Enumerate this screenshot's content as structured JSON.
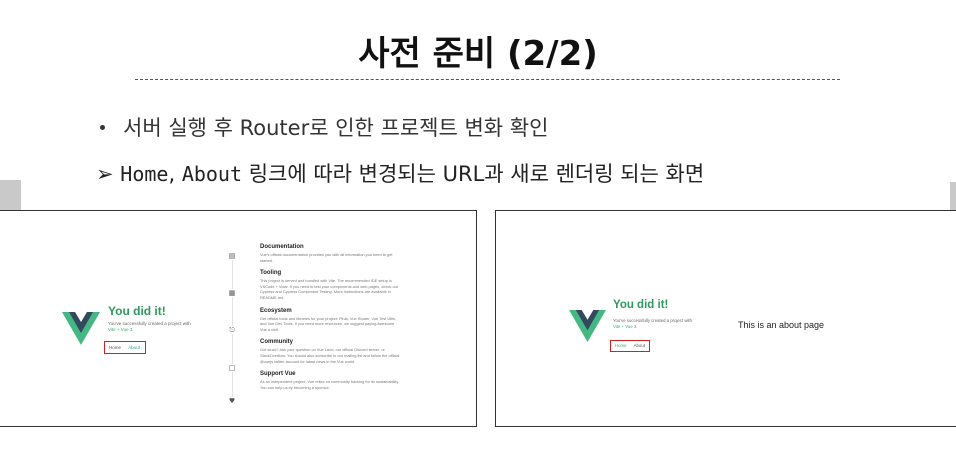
{
  "slide": {
    "title": "사전 준비 (2/2)",
    "bullet": "서버 실행 후 Router로 인한 프로젝트 변화 확인",
    "arrow_prefix": "➢ ",
    "arrow_home": "Home",
    "arrow_comma": ", ",
    "arrow_about": "About",
    "arrow_rest": " 링크에 따라 변경되는 URL과 새로 렌더링 되는 화면"
  },
  "screen_home": {
    "heading": "You did it!",
    "sub_text": "You've successfully created a project with",
    "sub_links": "Vite + Vue 3.",
    "nav_home": "Home",
    "nav_about": "About",
    "sections": [
      {
        "title": "Documentation",
        "body": "Vue's official documentation provides you with all information you need to get started."
      },
      {
        "title": "Tooling",
        "body": "This project is served and bundled with Vite. The recommended IDE setup is VSCode + Volar. If you need to test your components and web pages, check out Cypress and Cypress Component Testing. More instructions are available in README.md."
      },
      {
        "title": "Ecosystem",
        "body": "Get official tools and libraries for your project: Pinia, Vue Router, Vue Test Utils, and Vue Dev Tools. If you need more resources, we suggest paying Awesome Vue a visit."
      },
      {
        "title": "Community",
        "body": "Got stuck? Ask your question on Vue Land, our official Discord server, or StackOverflow. You should also subscribe to our mailing list and follow the official @vuejs twitter account for latest news in the Vue world."
      },
      {
        "title": "Support Vue",
        "body": "As an independent project, Vue relies on community backing for its sustainability. You can help us by becoming a sponsor."
      }
    ],
    "icons": [
      "book-icon",
      "toolbox-icon",
      "ecosystem-icon",
      "chat-icon",
      "heart-icon"
    ],
    "brand_color": "#42b883"
  },
  "screen_about": {
    "heading": "You did it!",
    "sub_text": "You've successfully created a project with",
    "sub_links": "Vite + Vue 3.",
    "nav_home": "Home",
    "nav_about": "About",
    "about_text": "This is an about page"
  }
}
